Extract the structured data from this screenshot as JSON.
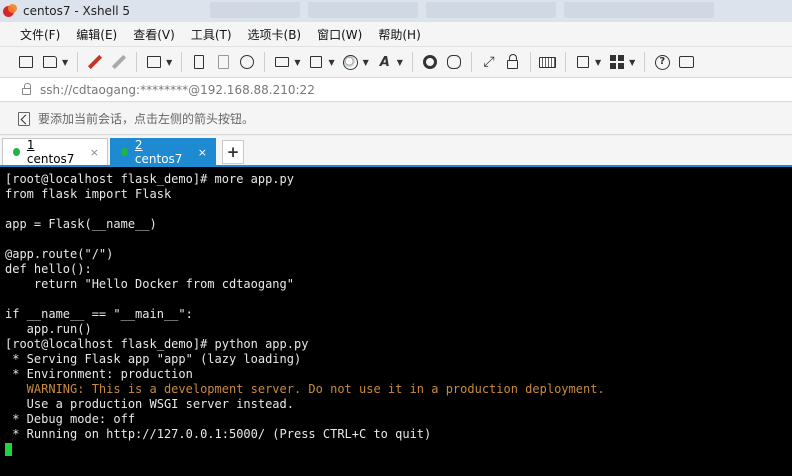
{
  "window": {
    "title": "centos7 - Xshell 5"
  },
  "menu": [
    "文件(F)",
    "编辑(E)",
    "查看(V)",
    "工具(T)",
    "选项卡(B)",
    "窗口(W)",
    "帮助(H)"
  ],
  "address": {
    "text": "ssh://cdtaogang:********@192.168.88.210:22"
  },
  "hint": {
    "text": "要添加当前会话，点击左侧的箭头按钮。"
  },
  "tabs": [
    {
      "index": "1",
      "name": "centos7",
      "active": false
    },
    {
      "index": "2",
      "name": "centos7",
      "active": true
    }
  ],
  "tab_add_label": "+",
  "tab_close_label": "×",
  "terminal": {
    "lines": [
      "[root@localhost flask_demo]# more app.py",
      "from flask import Flask",
      "",
      "app = Flask(__name__)",
      "",
      "@app.route(\"/\")",
      "def hello():",
      "    return \"Hello Docker from cdtaogang\"",
      "",
      "if __name__ == \"__main__\":",
      "   app.run()",
      "[root@localhost flask_demo]# python app.py",
      " * Serving Flask app \"app\" (lazy loading)",
      " * Environment: production",
      "   WARNING: This is a development server. Do not use it in a production deployment.",
      "   Use a production WSGI server instead.",
      " * Debug mode: off",
      " * Running on http://127.0.0.1:5000/ (Press CTRL+C to quit)"
    ],
    "warning_color": "#c88a3c",
    "cursor_color": "#1fd33a"
  },
  "colors": {
    "accent": "#1e8ad2",
    "connected_dot": "#1fb345"
  }
}
